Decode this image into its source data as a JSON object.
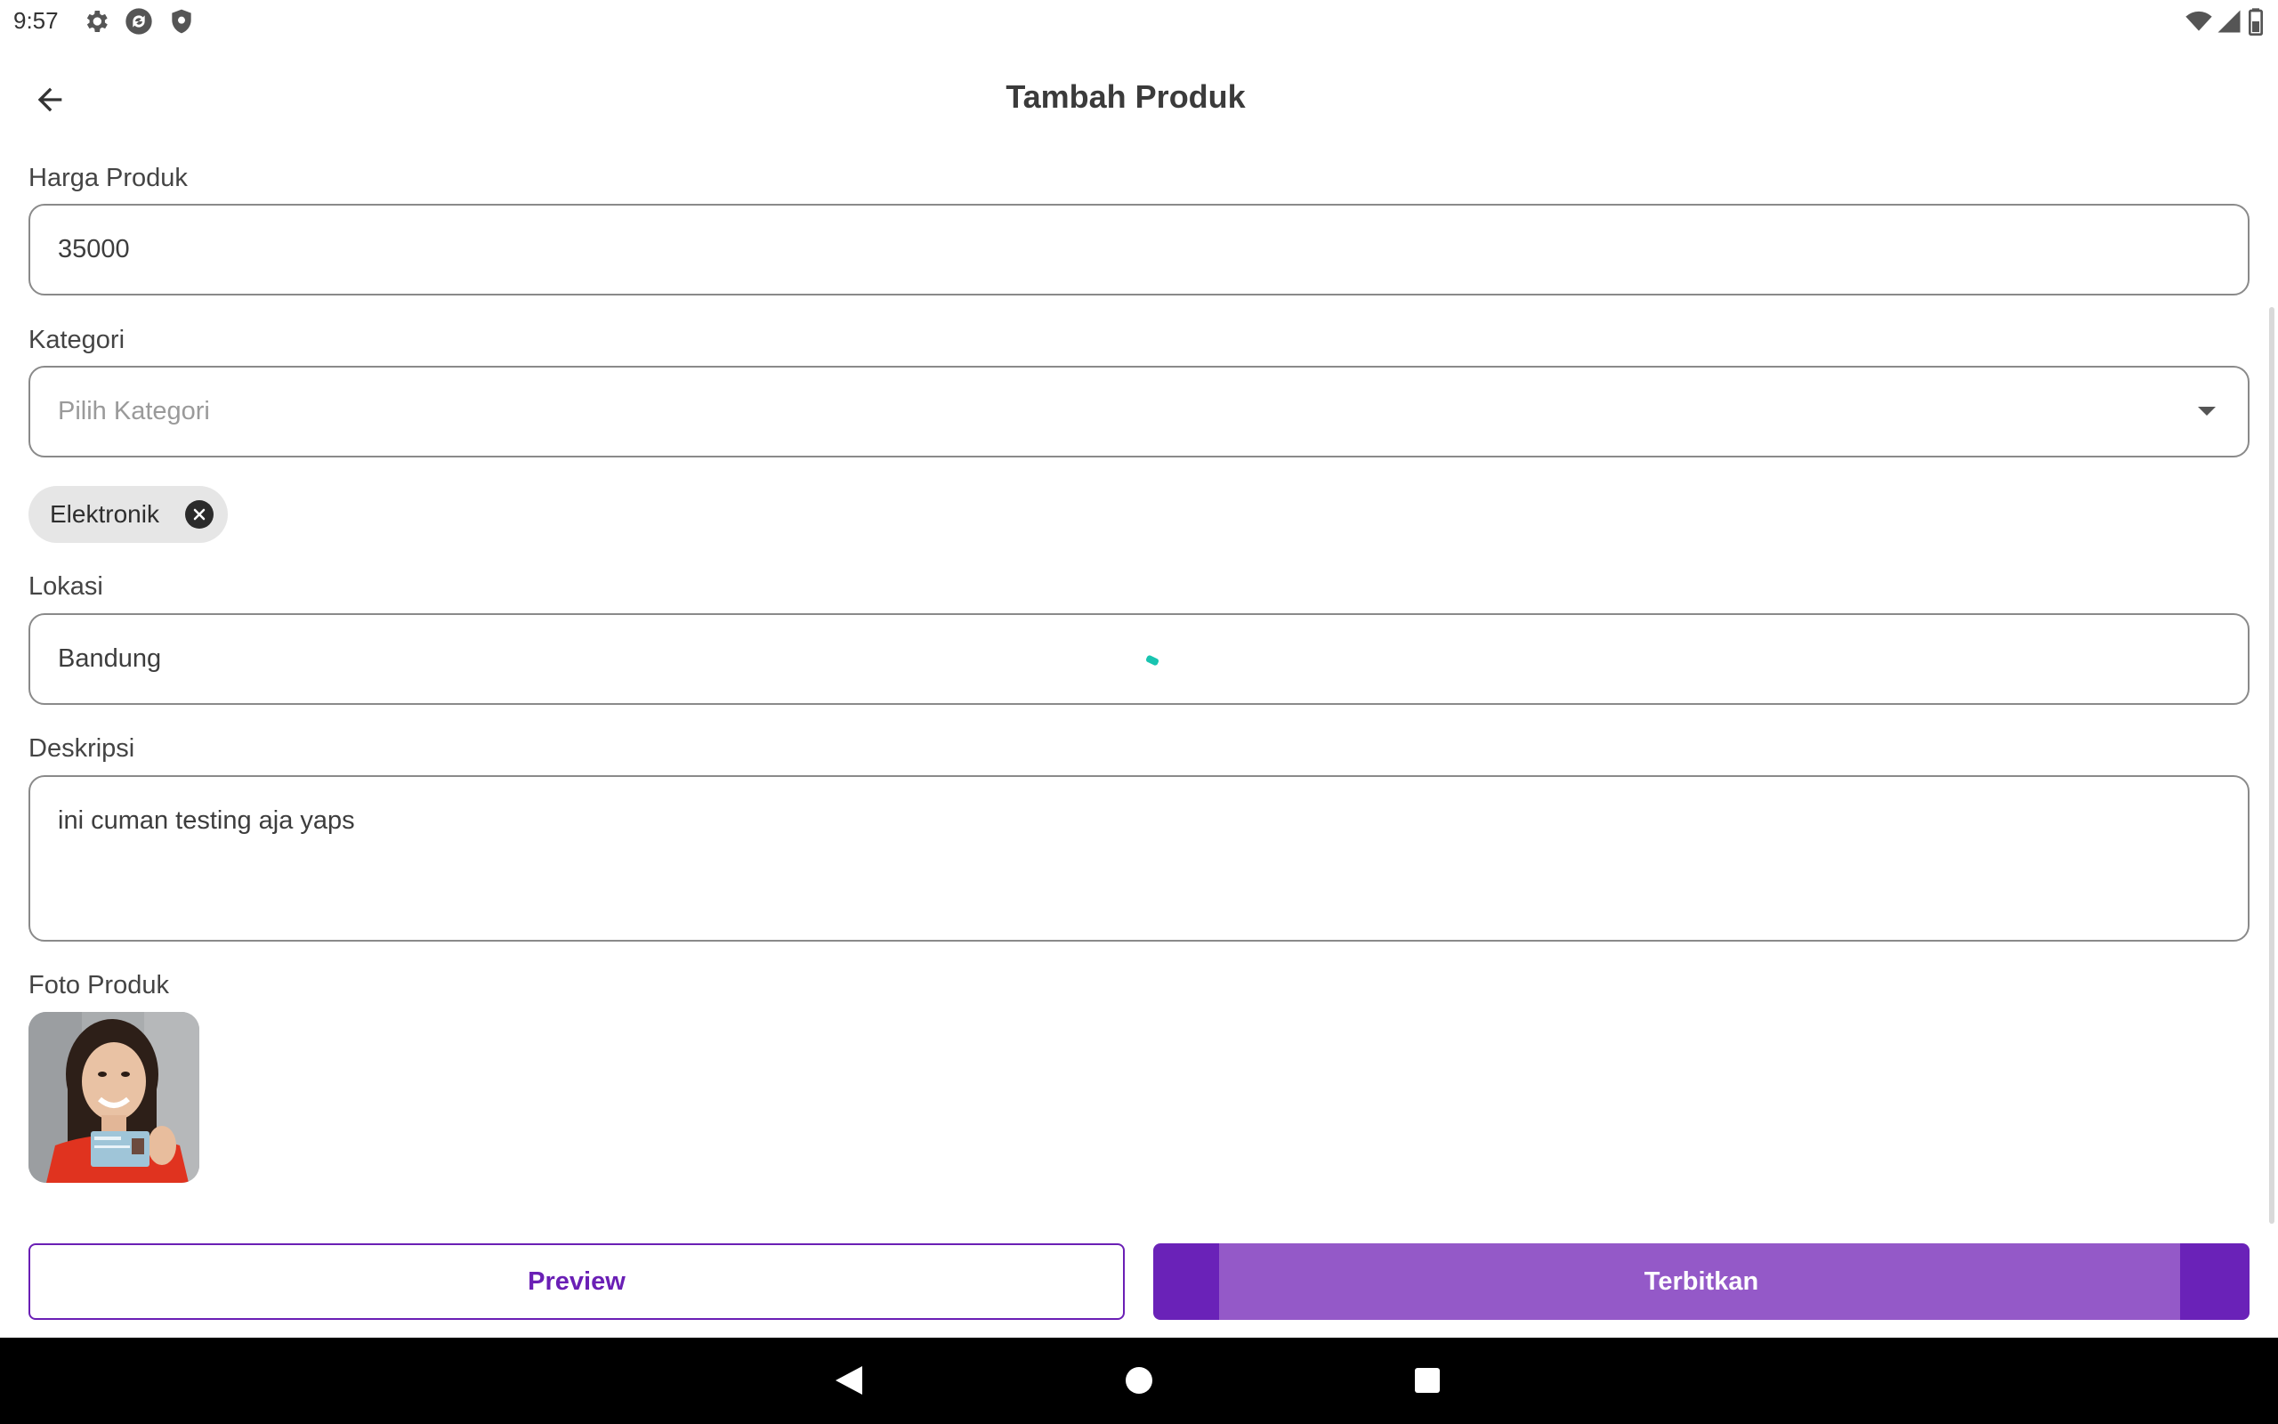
{
  "status_bar": {
    "time": "9:57",
    "left_icons": [
      "gear-icon",
      "sync-icon",
      "shield-icon"
    ],
    "right_icons": [
      "wifi-icon",
      "signal-icon",
      "battery-icon"
    ]
  },
  "app_bar": {
    "title": "Tambah Produk",
    "back_icon": "arrow-left-icon"
  },
  "form": {
    "price": {
      "label": "Harga Produk",
      "value": "35000"
    },
    "category": {
      "label": "Kategori",
      "placeholder": "Pilih Kategori",
      "selected_chips": [
        "Elektronik"
      ]
    },
    "location": {
      "label": "Lokasi",
      "value": "Bandung"
    },
    "description": {
      "label": "Deskripsi",
      "value": "ini cuman testing aja yaps"
    },
    "photo": {
      "label": "Foto Produk"
    }
  },
  "actions": {
    "preview_label": "Preview",
    "publish_label": "Terbitkan"
  },
  "colors": {
    "accent": "#6a22b8",
    "accent_light": "#9459c8",
    "spinner": "#19c4b0"
  },
  "nav_bar": {
    "icons": [
      "back-triangle-icon",
      "home-circle-icon",
      "recents-square-icon"
    ]
  }
}
